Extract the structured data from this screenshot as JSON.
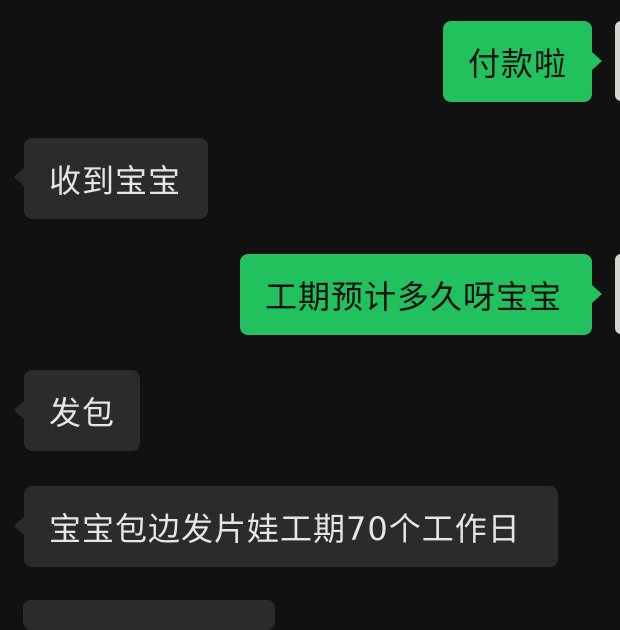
{
  "messages": [
    {
      "direction": "out",
      "text": "付款啦"
    },
    {
      "direction": "in",
      "text": "收到宝宝"
    },
    {
      "direction": "out",
      "text": "工期预计多久呀宝宝"
    },
    {
      "direction": "in",
      "text": "发包"
    },
    {
      "direction": "in",
      "text": "宝宝包边发片娃工期70个工作日"
    }
  ],
  "colors": {
    "background": "#111111",
    "outgoing_bubble": "#21c15e",
    "incoming_bubble": "#2b2b2b",
    "outgoing_text": "#111111",
    "incoming_text": "#e6e6e6"
  }
}
